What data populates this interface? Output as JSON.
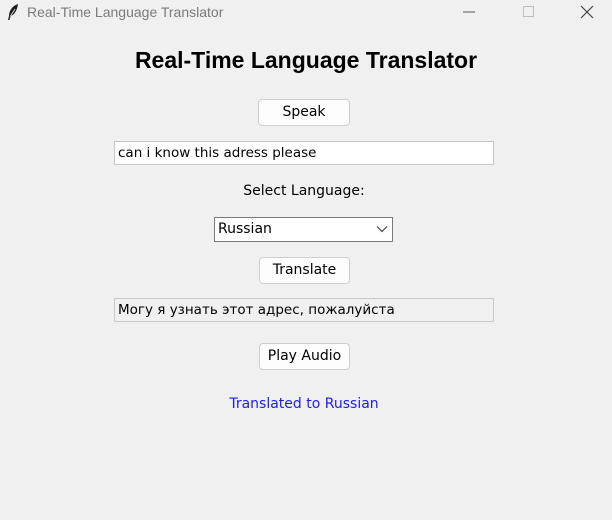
{
  "window": {
    "title": "Real-Time Language Translator",
    "icon": "feather-icon",
    "controls": [
      "minimize-icon",
      "maximize-icon",
      "close-icon"
    ]
  },
  "main": {
    "heading": "Real-Time Language Translator",
    "speak_label": "Speak",
    "input_value": "can i know this adress please",
    "select_label": "Select Language:",
    "language_selected": "Russian",
    "translate_label": "Translate",
    "output_value": "Могу я узнать этот адрес, пожалуйста",
    "play_label": "Play Audio",
    "status_text": "Translated to Russian"
  },
  "colors": {
    "background": "#f0f0f0",
    "status_text": "#1a1aff",
    "button_bg": "#fdfdfd",
    "entry_bg": "#ffffff"
  }
}
